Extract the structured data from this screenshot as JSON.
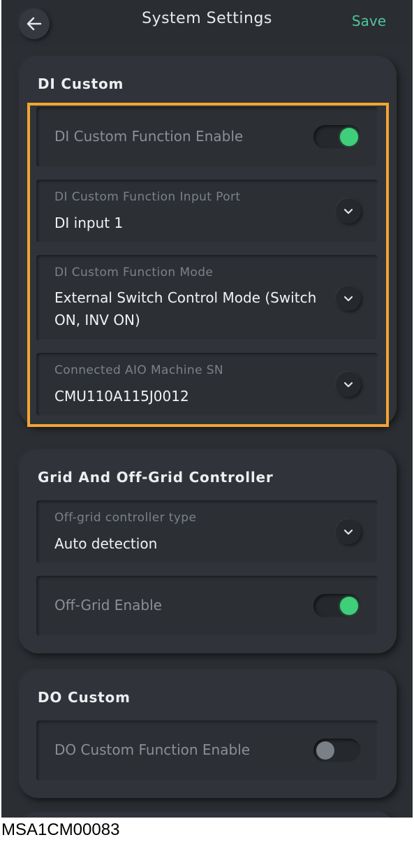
{
  "header": {
    "title": "System Settings",
    "save_label": "Save",
    "back_icon": "arrow-left-icon"
  },
  "sections": [
    {
      "title": "DI Custom",
      "rows": [
        {
          "label": "DI Custom Function Enable",
          "type": "toggle",
          "on": true
        },
        {
          "label": "DI Custom Function Input Port",
          "value": "DI input 1",
          "type": "select"
        },
        {
          "label": "DI Custom Function Mode",
          "value_line1": "External Switch Control Mode (Switch",
          "value_line2": "ON, INV ON)",
          "type": "select"
        },
        {
          "label": "Connected AIO Machine SN",
          "value": "CMU110A115J0012",
          "type": "select"
        }
      ]
    },
    {
      "title": "Grid And Off-Grid Controller",
      "rows": [
        {
          "label": "Off-grid controller type",
          "value": "Auto detection",
          "type": "select"
        },
        {
          "label": "Off-Grid Enable",
          "type": "toggle",
          "on": true
        }
      ]
    },
    {
      "title": "DO Custom",
      "rows": [
        {
          "label": "DO Custom Function Enable",
          "type": "toggle",
          "on": false
        }
      ]
    }
  ],
  "colors": {
    "accent": "#4fc59a",
    "toggle_on": "#3fcf7a",
    "highlight": "#f0a531",
    "background": "#2b2e33"
  },
  "caption": "MSA1CM00083"
}
